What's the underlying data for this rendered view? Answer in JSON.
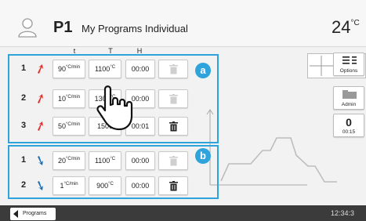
{
  "header": {
    "user_icon": "user-icon",
    "program_id": "P1",
    "program_name": "My Programs Individual",
    "temperature": "24",
    "temperature_unit": "°C"
  },
  "table": {
    "columns": [
      "t",
      "T",
      "H"
    ],
    "delete_icon": "trash-icon",
    "section_a": {
      "label": "a",
      "rows": [
        {
          "num": "1",
          "arrow": "up-arrow-icon",
          "arrow_color": "#e53030",
          "rate": "90",
          "rate_unit": "°C/min",
          "temp": "1100",
          "temp_unit": "°C",
          "hold": "00:00",
          "delete_active": false
        },
        {
          "num": "2",
          "arrow": "up-arrow-icon",
          "arrow_color": "#e53030",
          "rate": "10",
          "rate_unit": "°C/min",
          "temp": "1300",
          "temp_unit": "°C",
          "hold": "00:00",
          "delete_active": false
        },
        {
          "num": "3",
          "arrow": "up-arrow-icon",
          "arrow_color": "#e53030",
          "rate": "50",
          "rate_unit": "°C/min",
          "temp": "1500",
          "temp_unit": "",
          "hold": "00:01",
          "delete_active": true
        }
      ]
    },
    "section_b": {
      "label": "b",
      "rows": [
        {
          "num": "1",
          "arrow": "down-arrow-icon",
          "arrow_color": "#1f6fb0",
          "rate": "20",
          "rate_unit": "°C/min",
          "temp": "1100",
          "temp_unit": "°C",
          "hold": "00:00",
          "delete_active": false
        },
        {
          "num": "2",
          "arrow": "down-arrow-icon",
          "arrow_color": "#1f6fb0",
          "rate": "1",
          "rate_unit": "°C/min",
          "temp": "900",
          "temp_unit": "°C",
          "hold": "00:00",
          "delete_active": true
        }
      ]
    }
  },
  "sidebar": {
    "options_label": "Options",
    "admin_label": "Admin",
    "timer_value": "0",
    "timer_label": "00:15"
  },
  "footer": {
    "programs_label": "Programs",
    "clock": "12:34:3"
  },
  "colors": {
    "accent": "#2ea3dc",
    "heat_arrow": "#e53030",
    "cool_arrow": "#1f6fb0",
    "footer_bg": "#3b3b3b"
  }
}
